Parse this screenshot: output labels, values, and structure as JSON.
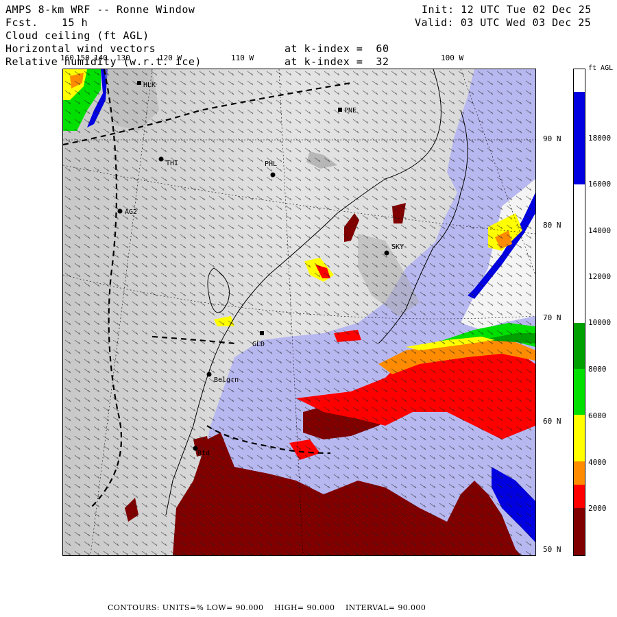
{
  "header": {
    "title": "AMPS 8-km WRF -- Ronne Window",
    "fcst_label": "Fcst.",
    "fcst_value": "15 h",
    "init_text": "Init: 12 UTC Tue 02 Dec 25",
    "valid_text": "Valid: 03 UTC Wed 03 Dec 25",
    "field1": "Cloud ceiling (ft AGL)",
    "field2": "Horizontal wind vectors",
    "field2_level": "at k-index =  60",
    "field3": "Relative humidity (w.r.t. ice)",
    "field3_level": "at k-index =  32"
  },
  "map": {
    "lon_labels": [
      "160",
      "150",
      "140",
      "130",
      "120 W",
      "110 W",
      "100 W"
    ],
    "lat_labels": [
      "90 N",
      "80 N",
      "70 N",
      "60 N",
      "50 N"
    ],
    "stations": [
      {
        "id": "HLK"
      },
      {
        "id": "PNE"
      },
      {
        "id": "THI"
      },
      {
        "id": "PHL"
      },
      {
        "id": "AG2"
      },
      {
        "id": "SKY"
      },
      {
        "id": "GLD"
      },
      {
        "id": "Belgrn"
      },
      {
        "id": "Rtd"
      }
    ]
  },
  "colorbar": {
    "unit": "ft AGL",
    "labels": [
      "18000",
      "16000",
      "14000",
      "12000",
      "10000",
      "8000",
      "6000",
      "4000",
      "2000"
    ],
    "colors": {
      "above_18000": "#ffffff",
      "16000_18000": "#0000e0",
      "10000_16000": "#ffffff",
      "8000_10000": "#00a000",
      "6000_8000": "#00e000",
      "4000_6000": "#ffff00",
      "3000_4000": "#ff8c00",
      "2000_3000": "#ff0000",
      "0_2000": "#800000"
    }
  },
  "footer": {
    "contours": "CONTOURS: UNITS=% LOW= 90.000",
    "high": "HIGH= 90.000",
    "interval": "INTERVAL= 90.000"
  }
}
